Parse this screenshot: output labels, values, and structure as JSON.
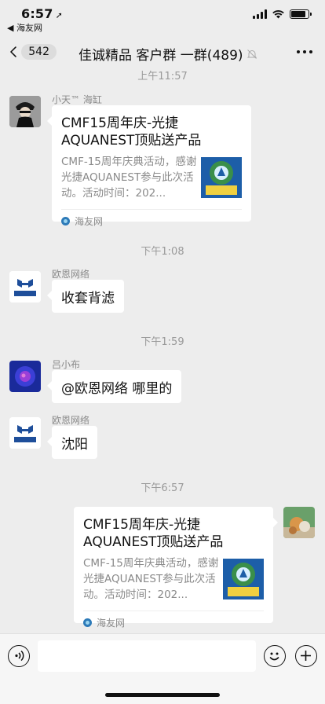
{
  "status_bar": {
    "time": "6:57",
    "location_arrow": "➚",
    "back_to_app": "◀ 海友网",
    "battery_level": 0.85,
    "signal_bars": 4
  },
  "nav": {
    "unread_count": "542",
    "title": "佳诚精品 客户群 一群(489)",
    "icons": [
      "back-chevron-icon",
      "mute-bell-icon",
      "more-icon"
    ]
  },
  "messages": [
    {
      "time": "上午11:57"
    },
    {
      "sender": "小天™ 海缸",
      "type": "link_card",
      "title": "CMF15周年庆-光捷AQUANEST顶贴送产品",
      "desc": "CMF-15周年庆典活动，感谢光捷AQUANEST参与此次活动。活动时间：202...",
      "source": "海友网"
    },
    {
      "time": "下午1:08"
    },
    {
      "sender": "欧恩网络",
      "type": "text",
      "text": "收套背滤"
    },
    {
      "time": "下午1:59"
    },
    {
      "sender": "吕小布",
      "type": "text",
      "text": "@欧恩网络 哪里的"
    },
    {
      "sender": "欧恩网络",
      "type": "text",
      "text": "沈阳"
    },
    {
      "time": "下午6:57"
    },
    {
      "sender": "self",
      "type": "link_card",
      "title": "CMF15周年庆-光捷AQUANEST顶贴送产品",
      "desc": "CMF-15周年庆典活动，感谢光捷AQUANEST参与此次活动。活动时间：202...",
      "source": "海友网"
    }
  ],
  "avatars": {
    "ouen_logo_text": "欧恩网络",
    "thumb_logo_text": "15周年"
  },
  "colors": {
    "background": "#ededed",
    "bubble": "#ffffff",
    "timestamp": "#9a9a9a"
  }
}
